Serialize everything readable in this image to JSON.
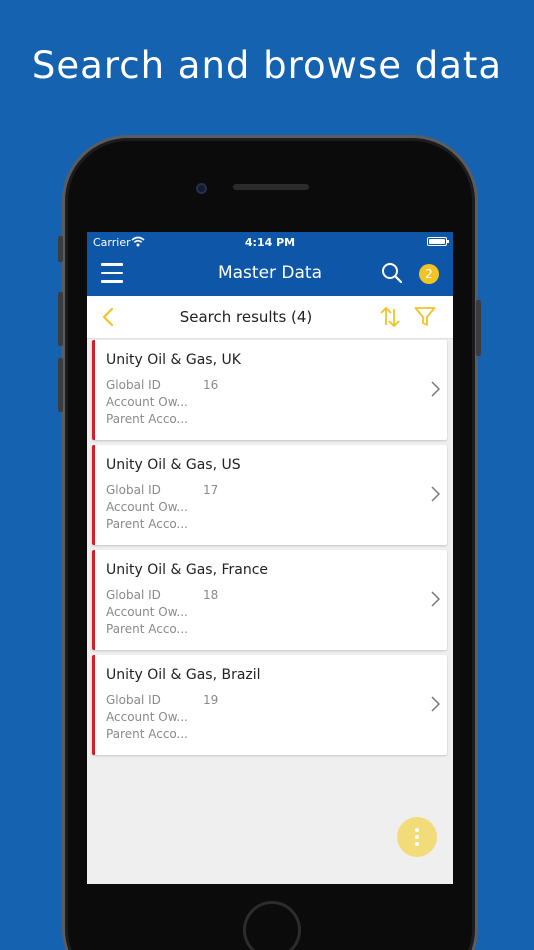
{
  "headline": "Search and browse data",
  "status_bar": {
    "carrier": "Carrier",
    "time": "4:14 PM"
  },
  "navbar": {
    "title": "Master Data",
    "notification_count": "2"
  },
  "subbar": {
    "title": "Search results (4)"
  },
  "results": [
    {
      "name": "Unity Oil & Gas, UK",
      "fields": [
        {
          "label": "Global ID",
          "value": "16"
        },
        {
          "label": "Account Ow...",
          "value": ""
        },
        {
          "label": "Parent Acco...",
          "value": ""
        }
      ]
    },
    {
      "name": "Unity Oil & Gas, US",
      "fields": [
        {
          "label": "Global ID",
          "value": "17"
        },
        {
          "label": "Account Ow...",
          "value": ""
        },
        {
          "label": "Parent Acco...",
          "value": ""
        }
      ]
    },
    {
      "name": "Unity Oil & Gas, France",
      "fields": [
        {
          "label": "Global ID",
          "value": "18"
        },
        {
          "label": "Account Ow...",
          "value": ""
        },
        {
          "label": "Parent Acco...",
          "value": ""
        }
      ]
    },
    {
      "name": "Unity Oil & Gas, Brazil",
      "fields": [
        {
          "label": "Global ID",
          "value": "19"
        },
        {
          "label": "Account Ow...",
          "value": ""
        },
        {
          "label": "Parent Acco...",
          "value": ""
        }
      ]
    }
  ],
  "icons": {
    "menu": "hamburger-menu-icon",
    "search": "search-icon",
    "back": "chevron-left-icon",
    "sort": "sort-icon",
    "filter": "filter-icon",
    "row_chevron": "chevron-right-icon",
    "fab": "more-vertical-icon",
    "wifi": "wifi-icon",
    "battery": "battery-icon"
  },
  "colors": {
    "background": "#1563b0",
    "app_bar": "#0e57a8",
    "accent_yellow": "#f2c323",
    "card_stripe": "#d0202e",
    "fab": "#f2dc7a"
  }
}
